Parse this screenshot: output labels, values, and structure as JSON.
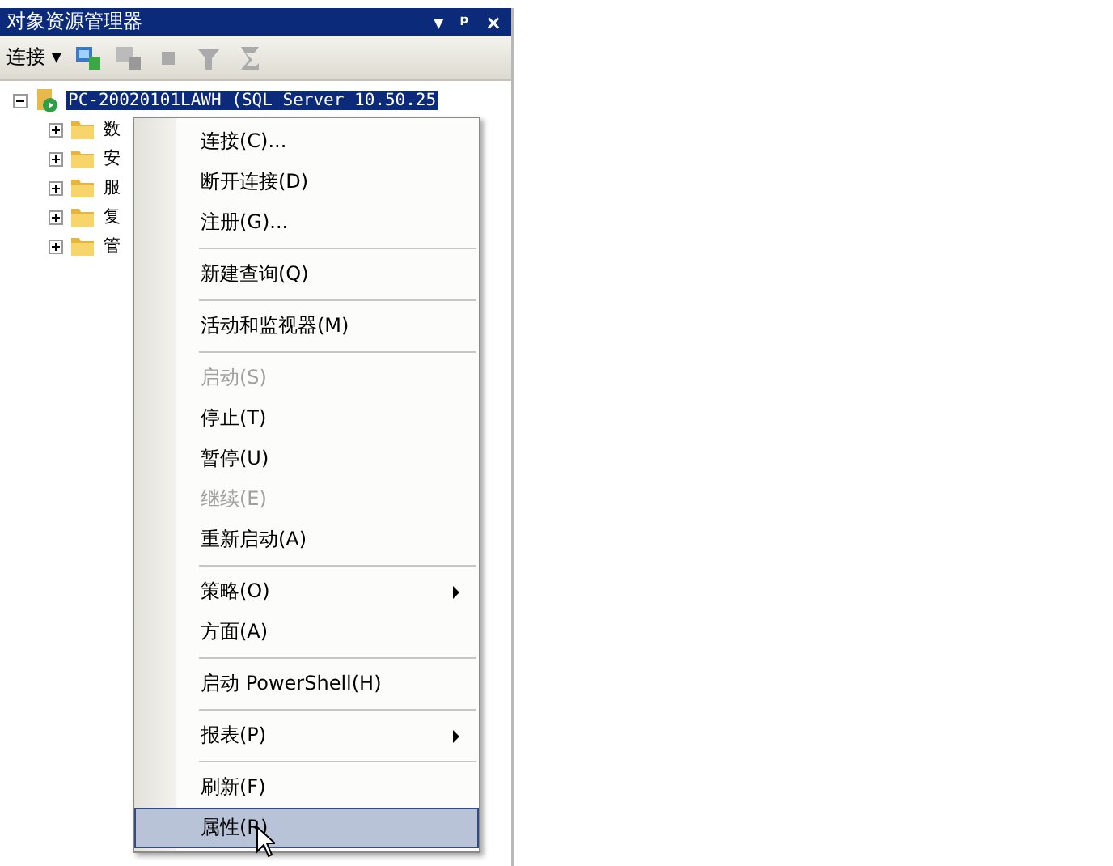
{
  "window": {
    "title": "对象资源管理器",
    "buttons": [
      "▾",
      "ᵖ",
      "×"
    ]
  },
  "toolbar": {
    "connect_label": "连接",
    "connect_caret": "▾"
  },
  "tree": {
    "root": {
      "label": "PC-20020101LAWH (SQL Server 10.50.25",
      "selected": true,
      "expanded": true
    },
    "children": [
      {
        "label": "数",
        "expanded": false
      },
      {
        "label": "安",
        "expanded": false
      },
      {
        "label": "服",
        "expanded": false
      },
      {
        "label": "复",
        "expanded": false
      },
      {
        "label": "管",
        "expanded": false
      }
    ]
  },
  "context_menu": {
    "items": [
      {
        "kind": "item",
        "label": "连接(C)...",
        "disabled": false,
        "submenu": false,
        "selected": false
      },
      {
        "kind": "item",
        "label": "断开连接(D)",
        "disabled": false,
        "submenu": false,
        "selected": false
      },
      {
        "kind": "item",
        "label": "注册(G)...",
        "disabled": false,
        "submenu": false,
        "selected": false
      },
      {
        "kind": "separator"
      },
      {
        "kind": "item",
        "label": "新建查询(Q)",
        "disabled": false,
        "submenu": false,
        "selected": false
      },
      {
        "kind": "separator"
      },
      {
        "kind": "item",
        "label": "活动和监视器(M)",
        "disabled": false,
        "submenu": false,
        "selected": false
      },
      {
        "kind": "separator"
      },
      {
        "kind": "item",
        "label": "启动(S)",
        "disabled": true,
        "submenu": false,
        "selected": false
      },
      {
        "kind": "item",
        "label": "停止(T)",
        "disabled": false,
        "submenu": false,
        "selected": false
      },
      {
        "kind": "item",
        "label": "暂停(U)",
        "disabled": false,
        "submenu": false,
        "selected": false
      },
      {
        "kind": "item",
        "label": "继续(E)",
        "disabled": true,
        "submenu": false,
        "selected": false
      },
      {
        "kind": "item",
        "label": "重新启动(A)",
        "disabled": false,
        "submenu": false,
        "selected": false
      },
      {
        "kind": "separator"
      },
      {
        "kind": "item",
        "label": "策略(O)",
        "disabled": false,
        "submenu": true,
        "selected": false
      },
      {
        "kind": "item",
        "label": "方面(A)",
        "disabled": false,
        "submenu": false,
        "selected": false
      },
      {
        "kind": "separator"
      },
      {
        "kind": "item",
        "label": "启动 PowerShell(H)",
        "disabled": false,
        "submenu": false,
        "selected": false
      },
      {
        "kind": "separator"
      },
      {
        "kind": "item",
        "label": "报表(P)",
        "disabled": false,
        "submenu": true,
        "selected": false
      },
      {
        "kind": "separator"
      },
      {
        "kind": "item",
        "label": "刷新(F)",
        "disabled": false,
        "submenu": false,
        "selected": false
      },
      {
        "kind": "item",
        "label": "属性(R)",
        "disabled": false,
        "submenu": false,
        "selected": true
      }
    ]
  }
}
